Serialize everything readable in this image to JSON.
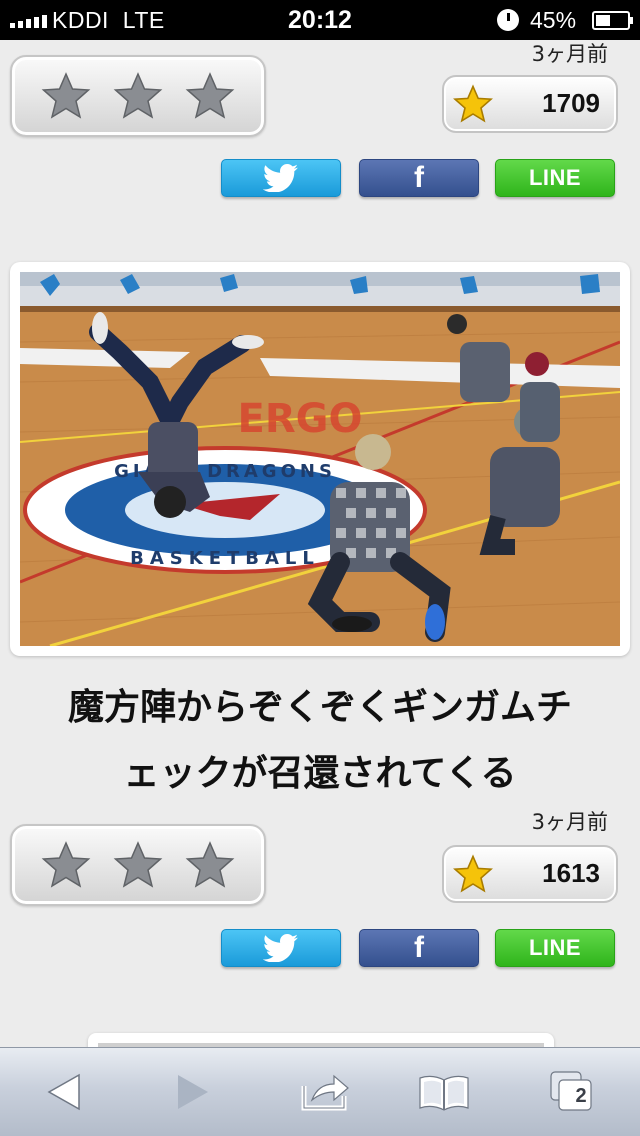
{
  "status_bar": {
    "carrier": "KDDI",
    "network": "LTE",
    "time": "20:12",
    "battery": "45%"
  },
  "posts": [
    {
      "timestamp": "3ヶ月前",
      "like_count": "1709",
      "share": {
        "line": "LINE",
        "facebook": "f"
      }
    },
    {
      "headline_line1": "魔方陣からぞくぞくギンガムチ",
      "headline_line2": "ェックが召還されてくる",
      "timestamp": "3ヶ月前",
      "like_count": "1613",
      "share": {
        "line": "LINE",
        "facebook": "f"
      }
    }
  ],
  "photo": {
    "banner_text": "ERGO",
    "center_text": "GIANT DRAGONS BASKETBALL"
  },
  "toolbar": {
    "tabs_count": "2"
  },
  "icons": {
    "rating_star": "star-outline-icon",
    "like_star": "gold-star-icon",
    "twitter": "twitter-bird-icon",
    "back": "back-arrow-icon",
    "forward": "forward-arrow-icon",
    "share": "share-icon",
    "bookmarks": "bookmarks-icon",
    "tabs": "tabs-icon"
  },
  "colors": {
    "twitter": "#1a9ad9",
    "facebook": "#3b5998",
    "line": "#2fb51b",
    "star_gold": "#f5c30a"
  }
}
